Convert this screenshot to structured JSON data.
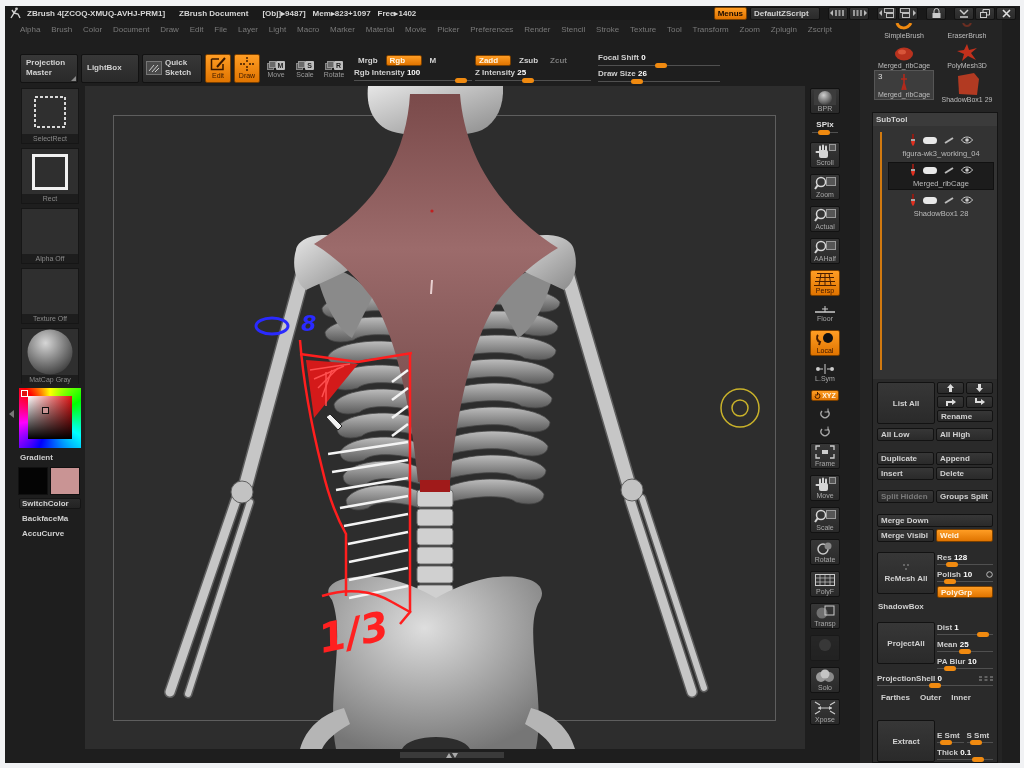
{
  "title_bar": {
    "app": "ZBrush 4[ZCOQ-XMUQ-AVHJ-PRM1]",
    "document": "ZBrush Document",
    "stats": [
      "[Obj]▸9487]",
      "Mem▸823+1097",
      "Free▸1402"
    ],
    "menus_button": {
      "label": "Menus",
      "on": true
    },
    "script": "DefaultZScript"
  },
  "menu_bar": [
    "Alpha",
    "Brush",
    "Color",
    "Document",
    "Draw",
    "Edit",
    "File",
    "Layer",
    "Light",
    "Macro",
    "Marker",
    "Material",
    "Movie",
    "Picker",
    "Preferences",
    "Render",
    "Stencil",
    "Stroke",
    "Texture",
    "Tool",
    "Transform",
    "Zoom",
    "Zplugin",
    "Zscript"
  ],
  "top_shelf": {
    "buttons": [
      {
        "kind": "text",
        "label": "Projection Master",
        "on": false
      },
      {
        "kind": "text",
        "label": "LightBox",
        "on": false
      },
      {
        "kind": "sketch",
        "label": "Quick Sketch",
        "on": false
      },
      {
        "kind": "edit",
        "label": "Edit",
        "on": true
      },
      {
        "kind": "draw",
        "label": "Draw",
        "on": true
      },
      {
        "kind": "gizmo",
        "label": "Move",
        "key": "M",
        "on": false
      },
      {
        "kind": "gizmo",
        "label": "Scale",
        "key": "S",
        "on": false
      },
      {
        "kind": "gizmo",
        "label": "Rotate",
        "key": "R",
        "on": false
      }
    ],
    "color_modes": [
      {
        "label": "Mrgb",
        "on": false
      },
      {
        "label": "Rgb",
        "on": true
      },
      {
        "label": "M",
        "on": false
      }
    ],
    "rgb_intensity": {
      "label": "Rgb Intensity",
      "value": "100",
      "level": 0.95
    },
    "z_modes": [
      {
        "label": "Zadd",
        "on": true,
        "disabled": false
      },
      {
        "label": "Zsub",
        "on": false,
        "disabled": false
      },
      {
        "label": "Zcut",
        "on": false,
        "disabled": true
      }
    ],
    "z_intensity": {
      "label": "Z Intensity",
      "value": "25",
      "level": 0.45
    },
    "focal_shift": {
      "label": "Focal Shift",
      "value": "0",
      "level": 0.52
    },
    "draw_size": {
      "label": "Draw Size",
      "value": "26",
      "level": 0.3
    }
  },
  "left_shelf": {
    "thumbnails": [
      {
        "kind": "select-rect",
        "label": "SelectRect"
      },
      {
        "kind": "rect",
        "label": "Rect"
      },
      {
        "kind": "blank",
        "label": "Alpha Off"
      },
      {
        "kind": "blank",
        "label": "Texture Off"
      },
      {
        "kind": "sphere",
        "label": "MatCap Gray"
      }
    ],
    "gradient": "Gradient",
    "colors": [
      {
        "color": "#040404"
      },
      {
        "color": "#c99494"
      }
    ],
    "buttons": [
      "SwitchColor",
      "BackfaceMa",
      "AccuCurve"
    ]
  },
  "canvas": {
    "annotations": [
      {
        "text": "8",
        "color": "#2a2aff"
      },
      {
        "text": "1/3",
        "color": "#ff2020"
      }
    ]
  },
  "right_shelf": [
    {
      "kind": "bpr",
      "label": "BPR",
      "on": false
    },
    {
      "kind": "spix",
      "label": "SPix",
      "level": 0.45,
      "on": false
    },
    {
      "kind": "scroll",
      "label": "Scroll",
      "on": false
    },
    {
      "kind": "zoom",
      "label": "Zoom",
      "on": false
    },
    {
      "kind": "actual",
      "label": "Actual",
      "on": false
    },
    {
      "kind": "aahalf",
      "label": "AAHalf",
      "on": false
    },
    {
      "kind": "persp",
      "label": "Persp",
      "on": true
    },
    {
      "kind": "floor",
      "label": "Floor",
      "on": false
    },
    {
      "kind": "local",
      "label": "Local",
      "on": true
    },
    {
      "kind": "lsym",
      "label": "L.Sym",
      "on": false
    },
    {
      "kind": "xyz",
      "label": "XYZ",
      "on": true
    },
    {
      "kind": "rotate-small",
      "on": false
    },
    {
      "kind": "rotate-small",
      "on": false
    },
    {
      "kind": "frame",
      "label": "Frame",
      "on": false
    },
    {
      "kind": "scroll",
      "label": "Move",
      "on": false
    },
    {
      "kind": "zoom",
      "label": "Scale",
      "on": false
    },
    {
      "kind": "rotate",
      "label": "Rotate",
      "on": false
    },
    {
      "kind": "polyf",
      "label": "PolyF",
      "on": false
    },
    {
      "kind": "transp",
      "label": "Transp",
      "on": false
    },
    {
      "kind": "ghost",
      "on": false
    },
    {
      "kind": "solo",
      "label": "Solo",
      "on": false
    },
    {
      "kind": "xpose",
      "label": "Xpose",
      "on": false
    }
  ],
  "tool_tray": [
    {
      "kind": "brush",
      "label": "SimpleBrush",
      "selected": false
    },
    {
      "kind": "eraser",
      "label": "EraserBrush",
      "selected": false
    },
    {
      "kind": "blob",
      "label": "Merged_ribCage",
      "selected": false
    },
    {
      "kind": "star",
      "label": "PolyMesh3D",
      "selected": false
    },
    {
      "kind": "figure",
      "label": "Merged_ribCage",
      "badge": "3",
      "selected": true
    },
    {
      "kind": "cube",
      "label": "ShadowBox1 29",
      "selected": false
    }
  ],
  "subtool": {
    "title": "SubTool",
    "items": [
      {
        "name": "figura-wk3_working_04",
        "selected": false
      },
      {
        "name": "Merged_ribCage",
        "selected": true
      },
      {
        "name": "ShadowBox1 28",
        "selected": false
      }
    ],
    "list_all": "List All",
    "rename": "Rename",
    "groups": [
      [
        [
          {
            "label": "All Low",
            "on": false,
            "disabled": false
          },
          {
            "label": "All High",
            "on": false,
            "disabled": false
          }
        ]
      ],
      [
        [
          {
            "label": "Duplicate",
            "on": false,
            "disabled": false
          },
          {
            "label": "Append",
            "on": false,
            "disabled": false
          }
        ],
        [
          {
            "label": "Insert",
            "on": false,
            "disabled": false
          },
          {
            "label": "Delete",
            "on": false,
            "disabled": false
          }
        ]
      ],
      [
        [
          {
            "label": "Split Hidden",
            "on": false,
            "disabled": true
          },
          {
            "label": "Groups Split",
            "on": false,
            "disabled": false
          }
        ]
      ],
      [
        [
          {
            "label": "Merge Down",
            "on": false,
            "disabled": false
          }
        ],
        [
          {
            "label": "Merge Visibl",
            "on": false,
            "disabled": false
          },
          {
            "label": "Weld",
            "on": true,
            "disabled": false
          }
        ]
      ]
    ],
    "remesh": {
      "button": "ReMesh All",
      "sliders": [
        {
          "label": "Res",
          "value": "128",
          "level": 0.2
        },
        {
          "label": "Polish",
          "value": "10",
          "level": 0.15
        }
      ],
      "toggle": {
        "label": "PolyGrp",
        "on": true
      }
    },
    "shadowbox": "ShadowBox",
    "project": {
      "button": "ProjectAll",
      "sliders": [
        {
          "label": "Dist",
          "value": "1",
          "level": 0.92
        },
        {
          "label": "Mean",
          "value": "25",
          "level": 0.5
        },
        {
          "label": "PA Blur",
          "value": "10",
          "level": 0.17
        }
      ],
      "shell": {
        "label": "ProjectionShell",
        "value": "0",
        "level": 0.5
      },
      "modes": [
        {
          "label": "Farthes",
          "on": false
        },
        {
          "label": "Outer",
          "on": false
        },
        {
          "label": "Inner",
          "on": false
        }
      ]
    },
    "extract": {
      "button": "Extract",
      "smooth": [
        {
          "label": "E Smt",
          "level": 0.2
        },
        {
          "label": "S Smt",
          "level": 0.25
        }
      ],
      "thick": {
        "label": "Thick",
        "value": "0.1",
        "level": 0.8
      }
    }
  }
}
